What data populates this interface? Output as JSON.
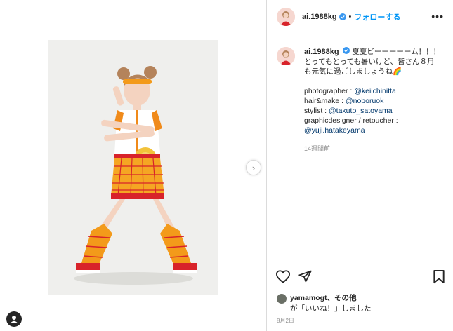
{
  "post": {
    "username": "ai.1988kg",
    "follow_label": "フォローする",
    "more_label": "•••",
    "next_label": "›"
  },
  "caption": {
    "username": "ai.1988kg",
    "lines": [
      "夏夏ビーーーーーム！！！",
      "とってもとっても暑いけど、皆さん８月",
      "も元気に過ごしましょうね🌈"
    ],
    "credits": [
      {
        "label": "photographer : ",
        "mention": "@keiichinitta"
      },
      {
        "label": "hair&make : ",
        "mention": "@noboruok"
      },
      {
        "label": "stylist : ",
        "mention": "@takuto_satoyama"
      },
      {
        "label": "graphicdesigner / retoucher :",
        "mention": ""
      },
      {
        "label": "",
        "mention": "@yuji.hatakeyama"
      }
    ],
    "time_ago": "14週間前"
  },
  "likes": {
    "user": "yamamogt",
    "separator": "、",
    "others": "その他",
    "line2": "が「いいね！」しました"
  },
  "date": "8月2日",
  "colors": {
    "accent": "#0095f6",
    "mention": "#00376b",
    "muted": "#8e8e8e",
    "border": "#dbdbdb"
  },
  "icons": {
    "verified": "verified-badge-icon",
    "heart": "heart-icon",
    "share": "paper-plane-icon",
    "bookmark": "bookmark-icon",
    "more": "more-options-icon",
    "next": "chevron-right-icon"
  }
}
